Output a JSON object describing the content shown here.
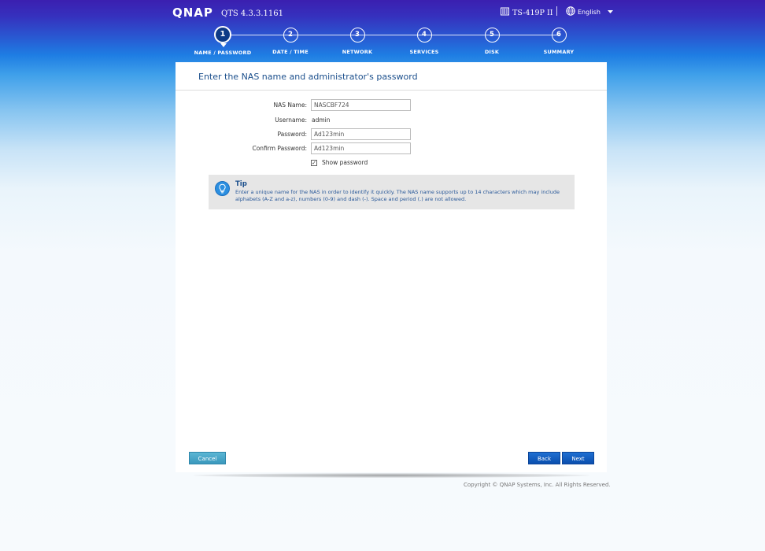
{
  "header": {
    "logo": "QNAP",
    "version": "QTS 4.3.3.1161",
    "model": "TS-419P II",
    "language": "English",
    "model_icon": "nas-device-icon",
    "language_icon": "globe-icon"
  },
  "steps": [
    {
      "number": "1",
      "label": "NAME / PASSWORD",
      "active": true
    },
    {
      "number": "2",
      "label": "DATE / TIME",
      "active": false
    },
    {
      "number": "3",
      "label": "NETWORK",
      "active": false
    },
    {
      "number": "4",
      "label": "SERVICES",
      "active": false
    },
    {
      "number": "5",
      "label": "DISK",
      "active": false
    },
    {
      "number": "6",
      "label": "SUMMARY",
      "active": false
    }
  ],
  "panel": {
    "title": "Enter the NAS name and administrator's password"
  },
  "form": {
    "nas_name_label": "NAS Name:",
    "nas_name_value": "NASCBF724",
    "username_label": "Username:",
    "username_value": "admin",
    "password_label": "Password:",
    "password_value": "Ad123min",
    "confirm_label": "Confirm Password:",
    "confirm_value": "Ad123min",
    "show_password_label": "Show password",
    "show_password_checked": true
  },
  "tip": {
    "title": "Tip",
    "text": "Enter a unique name for the NAS in order to identify it quickly. The NAS name supports up to 14 characters which may include alphabets (A-Z and a-z), numbers (0-9) and dash (-). Space and period (.) are not allowed.",
    "icon": "lightbulb-icon"
  },
  "buttons": {
    "cancel": "Cancel",
    "back": "Back",
    "next": "Next"
  },
  "footer": {
    "copyright": "Copyright © QNAP Systems, Inc. All Rights Reserved."
  },
  "colors": {
    "accent": "#1b4f8c",
    "primary_button": "#0b4fae",
    "cancel_button": "#3a98bd",
    "active_step": "#0d3a86"
  }
}
